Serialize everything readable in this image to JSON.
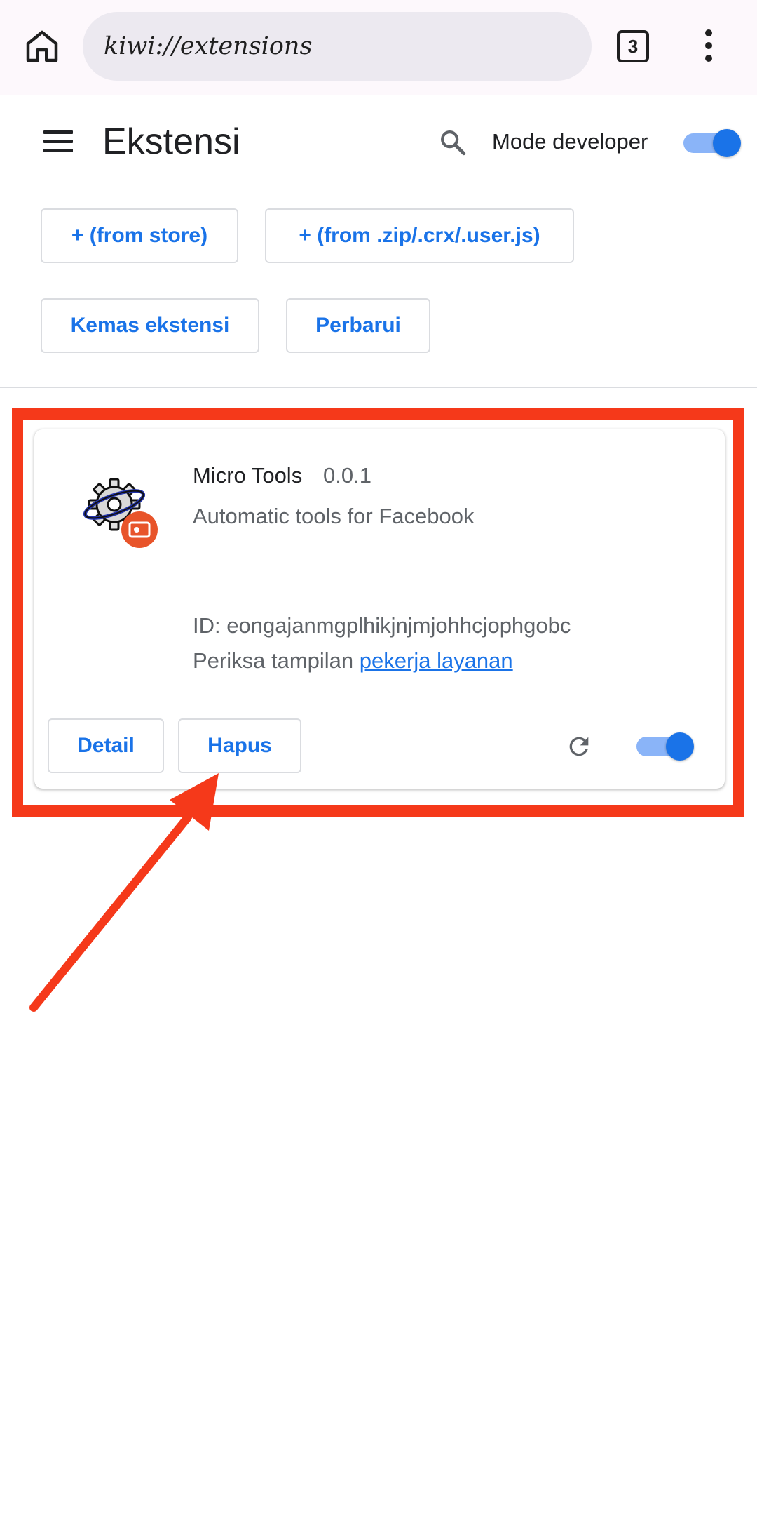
{
  "browser": {
    "url": "kiwi://extensions",
    "tab_count": "3",
    "icons": {
      "home": "home-icon",
      "menu": "more-vert-icon"
    }
  },
  "header": {
    "title": "Ekstensi",
    "dev_mode_label": "Mode developer",
    "dev_mode_enabled": true,
    "icons": {
      "menu": "hamburger-menu-icon",
      "search": "search-icon"
    }
  },
  "actions": {
    "from_store": "+ (from store)",
    "from_file": "+ (from .zip/.crx/.user.js)",
    "pack": "Kemas ekstensi",
    "update": "Perbarui"
  },
  "extension": {
    "name": "Micro Tools",
    "version": "0.0.1",
    "description": "Automatic tools for Facebook",
    "id_text": "ID: eongajanmgplhikjnjmjohhcjophgobc",
    "inspect_prefix": "Periksa tampilan",
    "inspect_link": "pekerja layanan",
    "detail_label": "Detail",
    "remove_label": "Hapus",
    "enabled": true,
    "icons": {
      "logo": "gear-extension-icon",
      "reload": "reload-icon"
    }
  },
  "annotation": {
    "highlight_color": "#f5391a",
    "arrow_color": "#f5391a"
  },
  "colors": {
    "accent": "#1a73e8",
    "toggle_track": "#8ab4f8",
    "chrome_bg": "#fdf8fc",
    "url_bg": "#ece9f0"
  }
}
